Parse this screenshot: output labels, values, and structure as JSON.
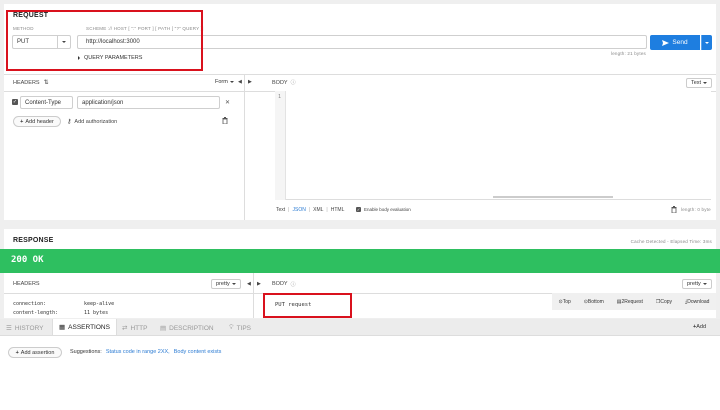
{
  "request": {
    "title": "REQUEST",
    "method_label": "METHOD",
    "method_value": "PUT",
    "url_hint": "SCHEME :// HOST [ \":\" PORT ] [ PATH [ \"?\" QUERY ]]",
    "url_value": "http://localhost:3000",
    "length_text": "length: 21 bytes",
    "query_params_label": "QUERY PARAMETERS",
    "send_label": "Send",
    "headers_label": "HEADERS",
    "form_label": "Form",
    "header_name": "Content-Type",
    "header_value": "application/json",
    "add_header_label": "Add header",
    "add_auth_label": "Add authorization",
    "body_label": "BODY",
    "body_format": "Text",
    "line_number": "1",
    "body_modes": [
      "Text",
      "JSON",
      "XML",
      "HTML"
    ],
    "enable_eval_label": "Enable body evaluation",
    "body_length": "length: 0 byte"
  },
  "response": {
    "title": "RESPONSE",
    "cache_info": "Cache Detected - Elapsed Time: 3ms",
    "status": "200 OK",
    "status_color": "#2ebf60",
    "headers_label": "HEADERS",
    "headers_format": "pretty",
    "body_label": "BODY",
    "body_format": "pretty",
    "header_rows": [
      {
        "name": "connection:",
        "value": "keep-alive"
      },
      {
        "name": "content-length:",
        "value": "11 bytes"
      }
    ],
    "body_text": "PUT request",
    "actions": [
      "Top",
      "Bottom",
      "2Request",
      "Copy",
      "Download"
    ]
  },
  "bottom_tabs": {
    "tabs": [
      "HISTORY",
      "ASSERTIONS",
      "HTTP",
      "DESCRIPTION",
      "TIPS"
    ],
    "active": "ASSERTIONS",
    "add_label": "Add",
    "add_assertion_label": "Add assertion",
    "suggestions_label": "Suggestions:",
    "suggestions": [
      "Status code in range 2XX,",
      "Body content exists"
    ]
  },
  "colors": {
    "accent": "#1e7ee0",
    "highlight_box": "#d9111d",
    "success": "#2ebf60"
  }
}
